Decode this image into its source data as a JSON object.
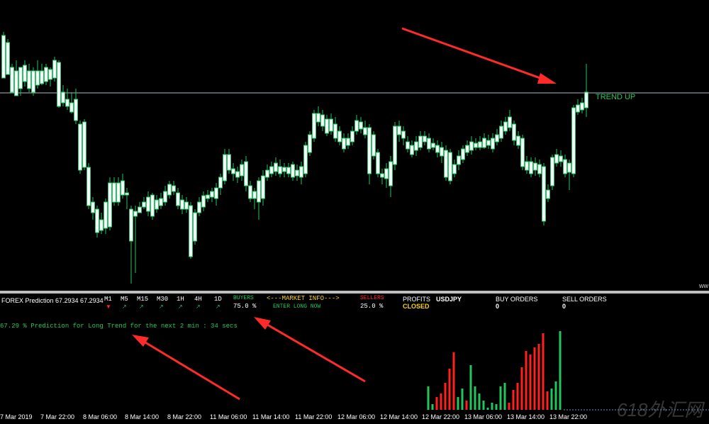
{
  "main": {
    "trend_label": "TREND UP",
    "corner_text": "ww",
    "candles": [
      [
        5,
        50,
        110,
        70,
        45
      ],
      [
        11,
        60,
        105,
        55,
        100
      ],
      [
        17,
        95,
        130,
        90,
        120
      ],
      [
        23,
        100,
        135,
        85,
        105
      ],
      [
        29,
        95,
        125,
        100,
        135
      ],
      [
        35,
        92,
        115,
        85,
        122
      ],
      [
        41,
        100,
        125,
        90,
        130
      ],
      [
        47,
        100,
        130,
        95,
        135
      ],
      [
        53,
        100,
        120,
        85,
        125
      ],
      [
        59,
        100,
        118,
        90,
        120
      ],
      [
        65,
        95,
        115,
        90,
        120
      ],
      [
        71,
        98,
        112,
        95,
        122
      ],
      [
        77,
        85,
        110,
        80,
        115
      ],
      [
        83,
        88,
        150,
        85,
        152
      ],
      [
        89,
        130,
        145,
        120,
        150
      ],
      [
        95,
        140,
        150,
        125,
        155
      ],
      [
        101,
        145,
        158,
        130,
        160
      ],
      [
        107,
        140,
        170,
        125,
        175
      ],
      [
        113,
        175,
        240,
        170,
        245
      ],
      [
        119,
        172,
        236,
        168,
        240
      ],
      [
        125,
        236,
        290,
        230,
        295
      ],
      [
        131,
        285,
        300,
        278,
        310
      ],
      [
        137,
        295,
        328,
        290,
        335
      ],
      [
        143,
        310,
        325,
        300,
        330
      ],
      [
        149,
        285,
        322,
        280,
        330
      ],
      [
        155,
        258,
        320,
        250,
        325
      ],
      [
        161,
        258,
        285,
        250,
        290
      ],
      [
        167,
        258,
        285,
        250,
        290
      ],
      [
        173,
        255,
        275,
        245,
        280
      ],
      [
        179,
        272,
        275,
        265,
        295
      ],
      [
        185,
        295,
        340,
        290,
        400
      ],
      [
        191,
        298,
        305,
        290,
        385
      ],
      [
        197,
        292,
        300,
        285,
        300
      ],
      [
        203,
        285,
        292,
        278,
        295
      ],
      [
        209,
        278,
        298,
        270,
        305
      ],
      [
        215,
        275,
        305,
        272,
        310
      ],
      [
        221,
        282,
        295,
        275,
        300
      ],
      [
        227,
        280,
        290,
        272,
        295
      ],
      [
        233,
        270,
        285,
        262,
        290
      ],
      [
        239,
        260,
        275,
        255,
        280
      ],
      [
        245,
        262,
        270,
        255,
        275
      ],
      [
        251,
        272,
        290,
        265,
        295
      ],
      [
        257,
        282,
        295,
        275,
        302
      ],
      [
        263,
        285,
        295,
        278,
        300
      ],
      [
        269,
        290,
        362,
        285,
        365
      ],
      [
        275,
        300,
        340,
        295,
        345
      ],
      [
        281,
        285,
        300,
        278,
        305
      ],
      [
        287,
        276,
        292,
        270,
        298
      ],
      [
        293,
        275,
        280,
        268,
        285
      ],
      [
        299,
        270,
        278,
        265,
        285
      ],
      [
        305,
        265,
        280,
        258,
        290
      ],
      [
        311,
        250,
        265,
        245,
        275
      ],
      [
        317,
        218,
        255,
        210,
        260
      ],
      [
        323,
        218,
        240,
        210,
        245
      ],
      [
        329,
        238,
        245,
        230,
        255
      ],
      [
        335,
        242,
        250,
        235,
        258
      ],
      [
        341,
        232,
        248,
        225,
        255
      ],
      [
        347,
        228,
        262,
        220,
        270
      ],
      [
        353,
        262,
        280,
        255,
        285
      ],
      [
        359,
        270,
        280,
        265,
        295
      ],
      [
        365,
        255,
        285,
        250,
        310
      ],
      [
        371,
        248,
        280,
        240,
        290
      ],
      [
        377,
        240,
        250,
        232,
        255
      ],
      [
        383,
        235,
        245,
        228,
        250
      ],
      [
        389,
        230,
        242,
        222,
        248
      ],
      [
        395,
        235,
        245,
        225,
        250
      ],
      [
        401,
        236,
        242,
        230,
        250
      ],
      [
        407,
        236,
        245,
        230,
        250
      ],
      [
        413,
        232,
        250,
        228,
        255
      ],
      [
        419,
        240,
        248,
        232,
        255
      ],
      [
        425,
        235,
        250,
        228,
        260
      ],
      [
        431,
        205,
        245,
        200,
        250
      ],
      [
        437,
        190,
        215,
        185,
        220
      ],
      [
        443,
        160,
        195,
        155,
        200
      ],
      [
        449,
        160,
        172,
        150,
        178
      ],
      [
        455,
        162,
        178,
        155,
        185
      ],
      [
        461,
        168,
        188,
        162,
        192
      ],
      [
        467,
        168,
        185,
        160,
        190
      ],
      [
        473,
        175,
        195,
        165,
        200
      ],
      [
        479,
        185,
        200,
        178,
        205
      ],
      [
        485,
        195,
        210,
        188,
        215
      ],
      [
        491,
        195,
        205,
        188,
        210
      ],
      [
        497,
        185,
        200,
        178,
        205
      ],
      [
        503,
        170,
        185,
        162,
        190
      ],
      [
        509,
        172,
        182,
        165,
        188
      ],
      [
        515,
        180,
        190,
        170,
        195
      ],
      [
        521,
        180,
        245,
        175,
        260
      ],
      [
        527,
        190,
        220,
        185,
        225
      ],
      [
        533,
        215,
        245,
        210,
        250
      ],
      [
        539,
        245,
        250,
        238,
        260
      ],
      [
        545,
        238,
        252,
        230,
        265
      ],
      [
        551,
        228,
        262,
        220,
        278
      ],
      [
        557,
        178,
        232,
        172,
        240
      ],
      [
        563,
        178,
        190,
        170,
        200
      ],
      [
        569,
        185,
        195,
        178,
        205
      ],
      [
        575,
        200,
        210,
        192,
        215
      ],
      [
        581,
        205,
        218,
        198,
        222
      ],
      [
        587,
        200,
        212,
        192,
        220
      ],
      [
        593,
        192,
        208,
        185,
        212
      ],
      [
        599,
        192,
        200,
        185,
        205
      ],
      [
        605,
        195,
        210,
        188,
        215
      ],
      [
        611,
        202,
        208,
        195,
        212
      ],
      [
        617,
        205,
        215,
        198,
        222
      ],
      [
        623,
        208,
        220,
        200,
        230
      ],
      [
        629,
        212,
        250,
        205,
        255
      ],
      [
        635,
        215,
        255,
        210,
        260
      ],
      [
        641,
        232,
        245,
        225,
        250
      ],
      [
        647,
        220,
        232,
        212,
        240
      ],
      [
        653,
        210,
        225,
        205,
        230
      ],
      [
        659,
        205,
        215,
        198,
        220
      ],
      [
        665,
        200,
        212,
        192,
        218
      ],
      [
        671,
        202,
        208,
        195,
        212
      ],
      [
        677,
        200,
        208,
        192,
        212
      ],
      [
        683,
        195,
        208,
        188,
        210
      ],
      [
        689,
        198,
        205,
        190,
        210
      ],
      [
        695,
        195,
        210,
        188,
        215
      ],
      [
        701,
        190,
        200,
        182,
        205
      ],
      [
        707,
        178,
        195,
        170,
        200
      ],
      [
        713,
        172,
        185,
        165,
        190
      ],
      [
        719,
        165,
        180,
        155,
        185
      ],
      [
        725,
        175,
        198,
        170,
        205
      ],
      [
        731,
        192,
        205,
        185,
        210
      ],
      [
        737,
        195,
        235,
        190,
        240
      ],
      [
        743,
        228,
        240,
        220,
        245
      ],
      [
        749,
        228,
        245,
        222,
        250
      ],
      [
        755,
        230,
        240,
        222,
        248
      ],
      [
        761,
        232,
        245,
        225,
        250
      ],
      [
        767,
        235,
        312,
        230,
        318
      ],
      [
        773,
        268,
        280,
        260,
        285
      ],
      [
        779,
        222,
        262,
        218,
        268
      ],
      [
        785,
        218,
        230,
        210,
        235
      ],
      [
        791,
        220,
        228,
        212,
        235
      ],
      [
        797,
        225,
        245,
        218,
        250
      ],
      [
        803,
        230,
        243,
        225,
        268
      ],
      [
        809,
        152,
        245,
        148,
        250
      ],
      [
        815,
        148,
        158,
        140,
        162
      ],
      [
        821,
        145,
        155,
        138,
        160
      ],
      [
        827,
        130,
        152,
        90,
        165
      ]
    ]
  },
  "indicator": {
    "title": "FOREX Prediction 67.2934 67.2934",
    "timeframes": [
      {
        "label": "M1",
        "dir": "down"
      },
      {
        "label": "M5",
        "dir": "up"
      },
      {
        "label": "M15",
        "dir": "up"
      },
      {
        "label": "M30",
        "dir": "up"
      },
      {
        "label": "1H",
        "dir": "up"
      },
      {
        "label": "4H",
        "dir": "up"
      },
      {
        "label": "1D",
        "dir": "up"
      }
    ],
    "buyers_label": "BUYERS",
    "buyers_value": "75.0 %",
    "market_info_label": "<---MARKET INFO--->",
    "enter_label": "ENTER LONG NOW",
    "sellers_label": "SELLERS",
    "sellers_value": "25.0 %",
    "profits_label": "PROFITS",
    "closed_label": "CLOSED",
    "symbol": "USDJPY",
    "buy_orders_label": "BUY ORDERS",
    "buy_orders_value": "0",
    "sell_orders_label": "SELL ORDERS",
    "sell_orders_value": "0",
    "prediction_text": "67.29 % Prediction for Long Trend for the next 2 min : 34 secs",
    "bars": [
      [
        604,
        545,
        "g"
      ],
      [
        610,
        570,
        "g"
      ],
      [
        616,
        560,
        "r"
      ],
      [
        622,
        555,
        "r"
      ],
      [
        628,
        540,
        "r"
      ],
      [
        634,
        520,
        "r"
      ],
      [
        640,
        497,
        "r"
      ],
      [
        646,
        560,
        "g"
      ],
      [
        652,
        548,
        "g"
      ],
      [
        658,
        565,
        "r"
      ],
      [
        664,
        515,
        "g"
      ],
      [
        670,
        545,
        "g"
      ],
      [
        676,
        555,
        "g"
      ],
      [
        682,
        565,
        "g"
      ],
      [
        688,
        575,
        "g"
      ],
      [
        694,
        568,
        "g"
      ],
      [
        700,
        570,
        "g"
      ],
      [
        706,
        545,
        "g"
      ],
      [
        712,
        540,
        "g"
      ],
      [
        718,
        568,
        "r"
      ],
      [
        724,
        550,
        "r"
      ],
      [
        730,
        540,
        "r"
      ],
      [
        736,
        518,
        "r"
      ],
      [
        742,
        495,
        "r"
      ],
      [
        748,
        500,
        "r"
      ],
      [
        754,
        490,
        "r"
      ],
      [
        760,
        485,
        "r"
      ],
      [
        766,
        470,
        "r"
      ],
      [
        772,
        552,
        "r"
      ],
      [
        778,
        548,
        "g"
      ],
      [
        784,
        538,
        "g"
      ],
      [
        790,
        467,
        "g"
      ]
    ]
  },
  "time_axis": [
    "7 Mar 2019",
    "7 Mar 22:00",
    "8 Mar 06:00",
    "8 Mar 14:00",
    "8 Mar 22:00",
    "11 Mar 06:00",
    "11 Mar 14:00",
    "11 Mar 22:00",
    "12 Mar 06:00",
    "12 Mar 14:00",
    "12 Mar 22:00",
    "13 Mar 06:00",
    "13 Mar 14:00",
    "13 Mar 22:00"
  ],
  "watermark": "618外汇网",
  "colors": {
    "bull": "#ffffff",
    "bear": "#000000",
    "wick": "#22c55e",
    "buy_bar": "#22c55e",
    "sell_bar": "#ff2020",
    "arrow": "#ff2a2a"
  }
}
